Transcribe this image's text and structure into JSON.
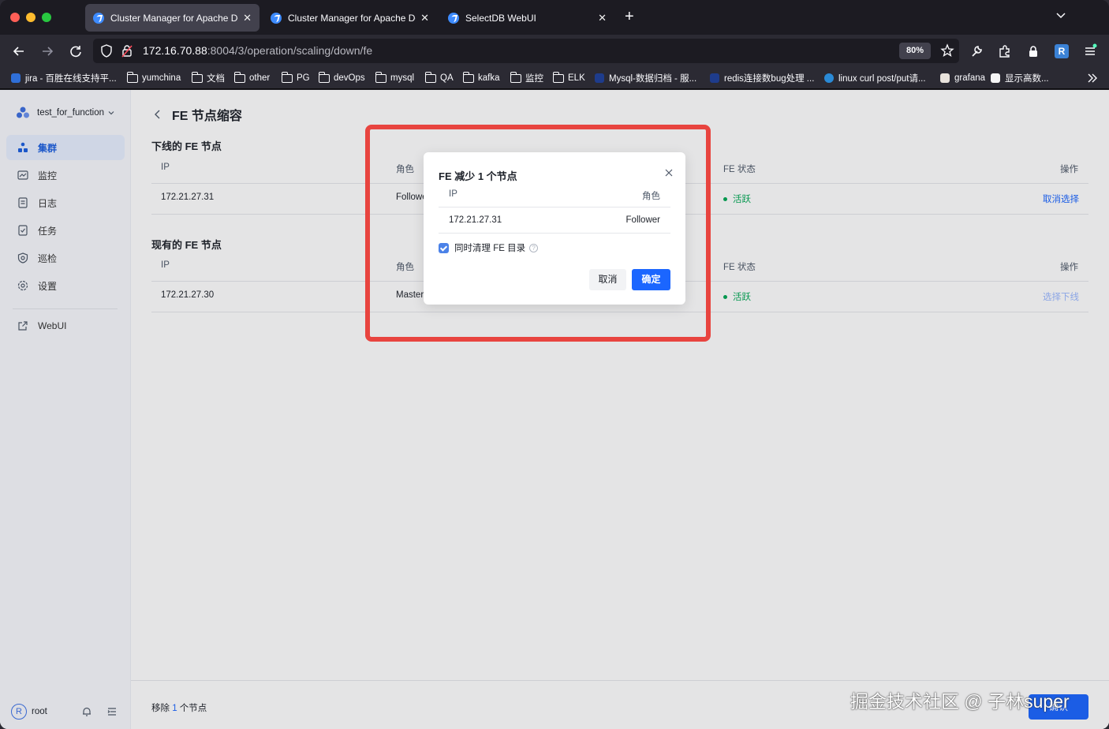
{
  "browser": {
    "tabs": [
      {
        "title": "Cluster Manager for Apache Doris",
        "active": true
      },
      {
        "title": "Cluster Manager for Apache Doris",
        "active": false
      },
      {
        "title": "SelectDB WebUI",
        "active": false
      }
    ],
    "url_host": "172.16.70.88",
    "url_rest": ":8004/3/operation/scaling/down/fe",
    "zoom": "80%",
    "extension_badge": "R",
    "bookmarks": [
      {
        "label": "jira - 百胜在线支持平...",
        "icon": "jira-icon"
      },
      {
        "label": "yumchina",
        "icon": "folder-icon"
      },
      {
        "label": "文档",
        "icon": "folder-icon"
      },
      {
        "label": "other",
        "icon": "folder-icon"
      },
      {
        "label": "PG",
        "icon": "folder-icon"
      },
      {
        "label": "devOps",
        "icon": "folder-icon"
      },
      {
        "label": "mysql",
        "icon": "folder-icon"
      },
      {
        "label": "QA",
        "icon": "folder-icon"
      },
      {
        "label": "kafka",
        "icon": "folder-icon"
      },
      {
        "label": "监控",
        "icon": "folder-icon"
      },
      {
        "label": "ELK",
        "icon": "folder-icon"
      },
      {
        "label": "Mysql-数据归档 - 服...",
        "icon": "page-icon"
      },
      {
        "label": "redis连接数bug处理 ...",
        "icon": "page-icon"
      },
      {
        "label": "linux curl post/put请...",
        "icon": "globe-icon"
      },
      {
        "label": "grafana",
        "icon": "image-icon"
      },
      {
        "label": "显示高数...",
        "icon": "chart-icon"
      }
    ]
  },
  "sidebar": {
    "project": "test_for_function",
    "items": [
      {
        "label": "集群",
        "icon": "cluster-icon",
        "active": true
      },
      {
        "label": "监控",
        "icon": "monitor-icon",
        "active": false
      },
      {
        "label": "日志",
        "icon": "log-icon",
        "active": false
      },
      {
        "label": "任务",
        "icon": "task-icon",
        "active": false
      },
      {
        "label": "巡检",
        "icon": "inspect-icon",
        "active": false
      },
      {
        "label": "设置",
        "icon": "settings-icon",
        "active": false
      },
      {
        "label": "WebUI",
        "icon": "external-link-icon",
        "active": false
      }
    ],
    "user": "root",
    "avatar_letter": "R"
  },
  "page": {
    "title": "FE 节点缩容",
    "offline_section": "下线的 FE 节点",
    "existing_section": "现有的 FE 节点",
    "columns": {
      "ip": "IP",
      "role": "角色",
      "status": "FE 状态",
      "action": "操作"
    },
    "offline_rows": [
      {
        "ip": "172.21.27.31",
        "role": "Follower",
        "status": "活跃",
        "action": "取消选择"
      }
    ],
    "existing_rows": [
      {
        "ip": "172.21.27.30",
        "role": "Master",
        "status": "活跃",
        "action": "选择下线"
      }
    ],
    "footer_prefix": "移除 ",
    "footer_count": "1",
    "footer_suffix": " 个节点",
    "footer_button": "确认"
  },
  "dialog": {
    "title": "FE 减少 1 个节点",
    "col_ip": "IP",
    "col_role": "角色",
    "row_ip": "172.21.27.31",
    "row_role": "Follower",
    "checkbox_label": "同时清理 FE 目录",
    "checkbox_checked": true,
    "cancel": "取消",
    "confirm": "确定"
  },
  "watermark": "掘金技术社区 @ 子林super",
  "colors": {
    "accent": "#1b66ff",
    "active_status": "#00a854",
    "highlight_box": "#e8443f"
  }
}
